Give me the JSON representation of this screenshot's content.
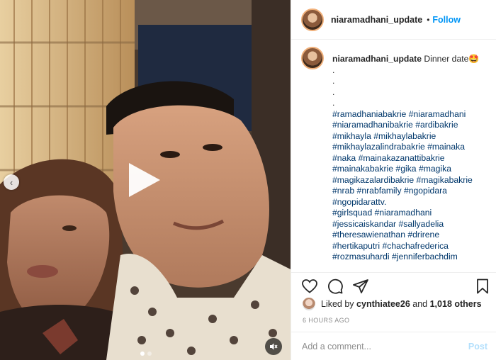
{
  "post": {
    "username": "niaramadhani_update",
    "follow_label": "Follow",
    "separator": "•"
  },
  "caption": {
    "username": "niaramadhani_update",
    "text": "Dinner date🤩",
    "dots": [
      ".",
      ".",
      ".",
      "."
    ],
    "hashtag_lines": [
      "#ramadhaniabakrie #niaramadhani",
      "#niaramadhanibakrie #ardibakrie",
      "#mikhayla #mikhaylabakrie",
      "#mikhaylazalindrabakrie #mainaka",
      "#naka #mainakazanattibakrie",
      "#mainakabakrie #gika #magika",
      "#magikazalardibakrie #magikabakrie",
      "#nrab #nrabfamily #ngopidara",
      "#ngopidarattv.",
      "#girlsquad #niaramadhani",
      "#jessicaiskandar #sallyadelia",
      "#theresawienathan #drirene",
      "#hertikaputri #chachafrederica",
      "#rozmasuhardi #jenniferbachdim"
    ]
  },
  "likes": {
    "prefix": "Liked by",
    "user": "cynthiatee26",
    "middle": "and",
    "count": "1,018 others"
  },
  "timestamp": "6 HOURS AGO",
  "comment": {
    "placeholder": "Add a comment...",
    "post_label": "Post"
  },
  "carousel": {
    "slide_count": 2,
    "active_index": 0
  },
  "icons": {
    "play": "play-icon",
    "prev": "chevron-left-icon",
    "volume": "speaker-muted-icon",
    "like": "heart-icon",
    "comment": "comment-icon",
    "share": "share-icon",
    "save": "bookmark-icon"
  }
}
